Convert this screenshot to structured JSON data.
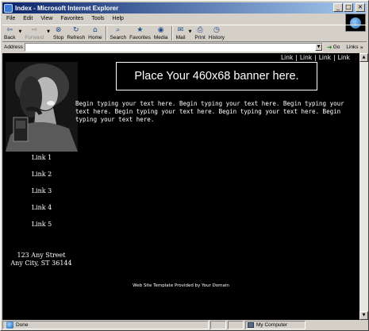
{
  "window": {
    "title": "Index - Microsoft Internet Explorer",
    "controls": {
      "minimize": "_",
      "maximize": "□",
      "close": "×"
    }
  },
  "menubar": [
    "File",
    "Edit",
    "View",
    "Favorites",
    "Tools",
    "Help"
  ],
  "toolbar": {
    "back": "Back",
    "forward": "Forward",
    "stop": "Stop",
    "refresh": "Refresh",
    "home": "Home",
    "search": "Search",
    "favorites": "Favorites",
    "media": "Media",
    "mail": "Mail",
    "print": "Print",
    "history": "History"
  },
  "addressbar": {
    "label": "Address",
    "value": "",
    "go": "Go",
    "links": "Links"
  },
  "page": {
    "top_links": [
      "Link",
      "Link",
      "Link",
      "Link"
    ],
    "top_link_sep": "|",
    "banner": "Place Your 460x68 banner here.",
    "body_text": "Begin typing your text here. Begin typing your text here. Begin typing your text here. Begin typing your text here. Begin typing your text here. Begin typing your text here.",
    "side_links": [
      "Link 1",
      "Link 2",
      "Link 3",
      "Link 4",
      "Link 5"
    ],
    "address_line1": "123 Any Street",
    "address_line2": "Any City, ST 36144",
    "credit": "Web Site Template Provided by Your Domain"
  },
  "statusbar": {
    "text": "Done",
    "zone": "My Computer"
  }
}
